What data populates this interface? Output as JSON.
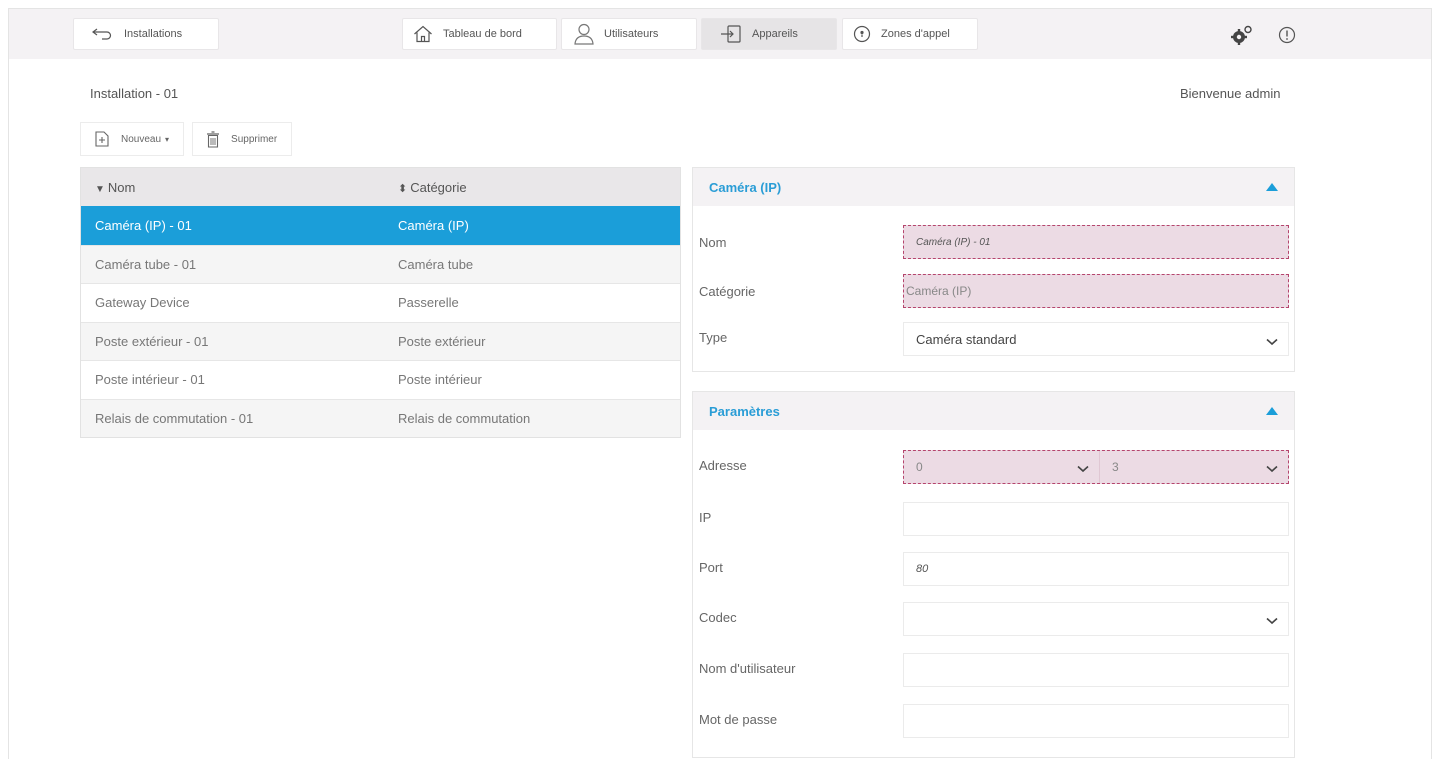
{
  "topbar": {
    "back_label": "Installations",
    "nav": [
      {
        "label": "Tableau de bord",
        "icon": "home-icon"
      },
      {
        "label": "Utilisateurs",
        "icon": "user-icon"
      },
      {
        "label": "Appareils",
        "icon": "device-icon",
        "active": true
      },
      {
        "label": "Zones d'appel",
        "icon": "location-pin-icon"
      }
    ],
    "right_icons": [
      "gears-icon",
      "info-icon"
    ]
  },
  "page": {
    "title": "Installation - 01",
    "welcome": "Bienvenue admin"
  },
  "actions": {
    "new_label": "Nouveau",
    "delete_label": "Supprimer"
  },
  "device_table": {
    "columns": [
      "Nom",
      "Catégorie"
    ],
    "rows": [
      {
        "name": "Caméra (IP) - 01",
        "category": "Caméra (IP)",
        "selected": true
      },
      {
        "name": "Caméra tube - 01",
        "category": "Caméra tube"
      },
      {
        "name": "Gateway Device",
        "category": "Passerelle"
      },
      {
        "name": "Poste extérieur - 01",
        "category": "Poste extérieur"
      },
      {
        "name": "Poste intérieur - 01",
        "category": "Poste intérieur"
      },
      {
        "name": "Relais de commutation - 01",
        "category": "Relais de commutation"
      }
    ]
  },
  "panel_device": {
    "title": "Caméra (IP)",
    "fields": {
      "name_label": "Nom",
      "name_value": "Caméra (IP) - 01",
      "category_label": "Catégorie",
      "category_value": "Caméra (IP)",
      "type_label": "Type",
      "type_value": "Caméra standard"
    }
  },
  "panel_params": {
    "title": "Paramètres",
    "fields": {
      "address_label": "Adresse",
      "address_value_1": "0",
      "address_value_2": "3",
      "ip_label": "IP",
      "ip_value": "",
      "port_label": "Port",
      "port_value": "80",
      "codec_label": "Codec",
      "codec_value": "",
      "username_label": "Nom d'utilisateur",
      "username_value": "",
      "password_label": "Mot de passe",
      "password_value": ""
    }
  },
  "colors": {
    "accent": "#1b9ed9",
    "error_fill": "#ecdbe4",
    "error_border": "#b5456d"
  }
}
